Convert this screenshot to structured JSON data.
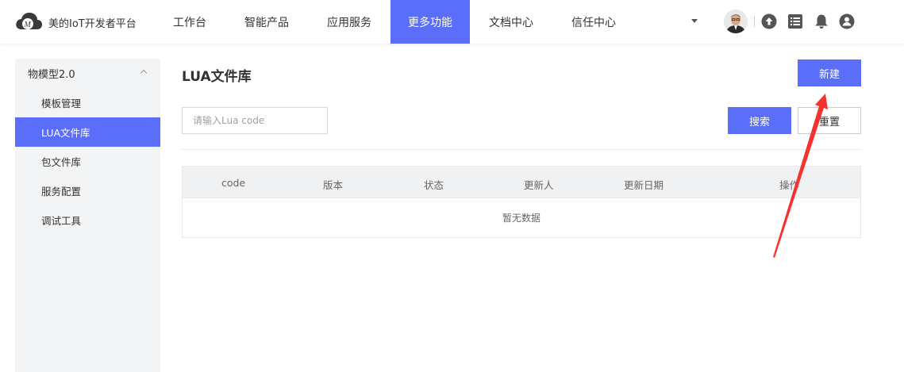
{
  "header": {
    "brand": "美的IoT开发者平台",
    "nav": [
      "工作台",
      "智能产品",
      "应用服务",
      "更多功能",
      "文档中心",
      "信任中心"
    ],
    "active_nav": "更多功能"
  },
  "sidebar": {
    "group": "物模型2.0",
    "items": [
      "模板管理",
      "LUA文件库",
      "包文件库",
      "服务配置",
      "调试工具"
    ],
    "active_item": "LUA文件库"
  },
  "main": {
    "title": "LUA文件库",
    "new_button": "新建",
    "search_placeholder": "请输入Lua code",
    "search_button": "搜索",
    "reset_button": "重置",
    "table": {
      "columns": [
        "code",
        "版本",
        "状态",
        "更新人",
        "更新日期",
        "操作"
      ],
      "empty_text": "暂无数据"
    }
  },
  "colors": {
    "accent": "#5b6ef9",
    "annotation_arrow": "#f4322f"
  },
  "icons": [
    "cloud-logo-icon",
    "caret-down-icon",
    "upload-icon",
    "list-icon",
    "bell-icon",
    "user-icon"
  ]
}
